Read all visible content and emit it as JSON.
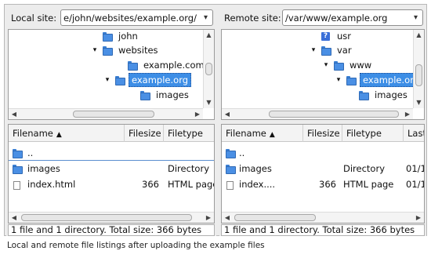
{
  "local": {
    "site_label": "Local site:",
    "path": "e/john/websites/example.org/",
    "tree": [
      {
        "label": "john",
        "expander": "",
        "icon": "folder-icon",
        "selected": false
      },
      {
        "label": "websites",
        "expander": "▾",
        "icon": "folder-icon",
        "selected": false
      },
      {
        "label": "example.com",
        "expander": "",
        "icon": "folder-icon",
        "selected": false
      },
      {
        "label": "example.org",
        "expander": "▾",
        "icon": "folder-icon",
        "selected": true
      },
      {
        "label": "images",
        "expander": "",
        "icon": "folder-icon",
        "selected": false
      }
    ],
    "columns": {
      "filename": "Filename",
      "filesize": "Filesize",
      "filetype": "Filetype"
    },
    "files": [
      {
        "name": "..",
        "size": "",
        "type": "",
        "icon": "folder-icon"
      },
      {
        "name": "images",
        "size": "",
        "type": "Directory",
        "icon": "folder-icon"
      },
      {
        "name": "index.html",
        "size": "366",
        "type": "HTML page",
        "icon": "file-icon"
      }
    ],
    "status": "1 file and 1 directory. Total size: 366 bytes"
  },
  "remote": {
    "site_label": "Remote site:",
    "path": "/var/www/example.org",
    "tree": [
      {
        "label": "usr",
        "expander": "",
        "icon": "unknown-folder-icon",
        "selected": false
      },
      {
        "label": "var",
        "expander": "▾",
        "icon": "folder-icon",
        "selected": false
      },
      {
        "label": "www",
        "expander": "▾",
        "icon": "folder-icon",
        "selected": false
      },
      {
        "label": "example.org",
        "expander": "▾",
        "icon": "folder-icon",
        "selected": true
      },
      {
        "label": "images",
        "expander": "",
        "icon": "folder-icon",
        "selected": false
      }
    ],
    "columns": {
      "filename": "Filename",
      "filesize": "Filesize",
      "filetype": "Filetype",
      "last": "Last"
    },
    "files": [
      {
        "name": "..",
        "size": "",
        "type": "",
        "last": "",
        "icon": "folder-icon"
      },
      {
        "name": "images",
        "size": "",
        "type": "Directory",
        "last": "01/1",
        "icon": "folder-icon"
      },
      {
        "name": "index....",
        "size": "366",
        "type": "HTML page",
        "last": "01/1",
        "icon": "file-icon"
      }
    ],
    "status": "1 file and 1 directory. Total size: 366 bytes"
  },
  "caption": "Local and remote file listings after uploading the example files",
  "colors": {
    "selection": "#3d8ee6",
    "folder": "#4a8fe4",
    "panel": "#ececec"
  }
}
